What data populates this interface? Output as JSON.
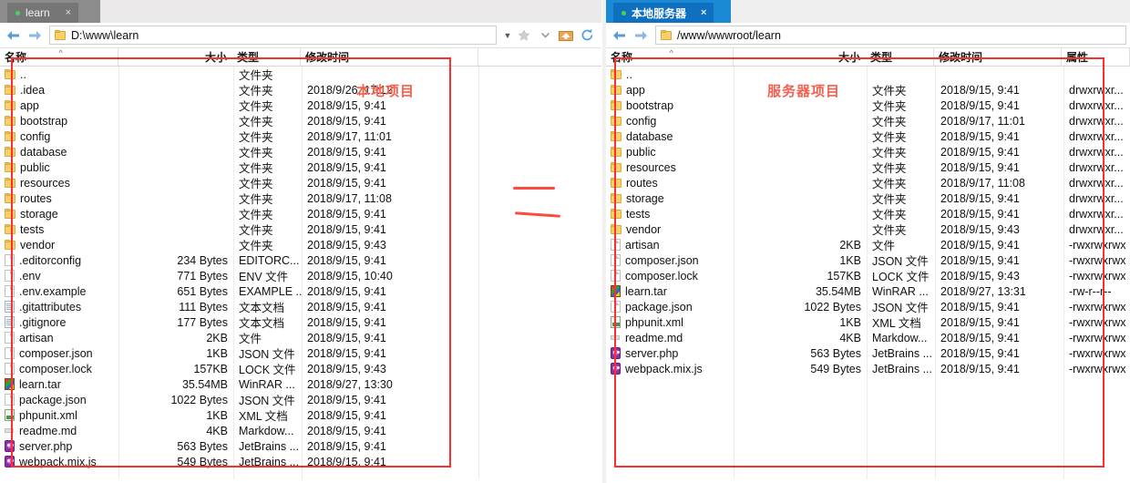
{
  "left_panel": {
    "tab": {
      "label": "learn",
      "close": "×",
      "status_dot": "connected"
    },
    "address": {
      "path": "D:\\www\\learn",
      "placeholder": "D:\\www\\learn"
    },
    "toolbar": {
      "back": "back-arrow",
      "forward": "forward-arrow",
      "dropdown": "chevron-down-icon",
      "favorite": "star-icon",
      "favorite_menu": "chevron-down-icon",
      "home": "home-folder-icon",
      "refresh": "refresh-icon"
    },
    "columns": [
      "名称",
      "大小",
      "类型",
      "修改时间"
    ],
    "sort_indicator": "^",
    "annotation": "本地项目",
    "rows": [
      {
        "name": "..",
        "icon": "folder",
        "size": "",
        "type": "文件夹",
        "date": ""
      },
      {
        "name": ".idea",
        "icon": "folder",
        "size": "",
        "type": "文件夹",
        "date": "2018/9/26, 17:12"
      },
      {
        "name": "app",
        "icon": "folder",
        "size": "",
        "type": "文件夹",
        "date": "2018/9/15, 9:41"
      },
      {
        "name": "bootstrap",
        "icon": "folder",
        "size": "",
        "type": "文件夹",
        "date": "2018/9/15, 9:41"
      },
      {
        "name": "config",
        "icon": "folder",
        "size": "",
        "type": "文件夹",
        "date": "2018/9/17, 11:01"
      },
      {
        "name": "database",
        "icon": "folder",
        "size": "",
        "type": "文件夹",
        "date": "2018/9/15, 9:41"
      },
      {
        "name": "public",
        "icon": "folder",
        "size": "",
        "type": "文件夹",
        "date": "2018/9/15, 9:41"
      },
      {
        "name": "resources",
        "icon": "folder",
        "size": "",
        "type": "文件夹",
        "date": "2018/9/15, 9:41"
      },
      {
        "name": "routes",
        "icon": "folder",
        "size": "",
        "type": "文件夹",
        "date": "2018/9/17, 11:08"
      },
      {
        "name": "storage",
        "icon": "folder",
        "size": "",
        "type": "文件夹",
        "date": "2018/9/15, 9:41"
      },
      {
        "name": "tests",
        "icon": "folder",
        "size": "",
        "type": "文件夹",
        "date": "2018/9/15, 9:41"
      },
      {
        "name": "vendor",
        "icon": "folder",
        "size": "",
        "type": "文件夹",
        "date": "2018/9/15, 9:43"
      },
      {
        "name": ".editorconfig",
        "icon": "doc",
        "size": "234 Bytes",
        "type": "EDITORC...",
        "date": "2018/9/15, 9:41"
      },
      {
        "name": ".env",
        "icon": "doc",
        "size": "771 Bytes",
        "type": "ENV 文件",
        "date": "2018/9/15, 10:40"
      },
      {
        "name": ".env.example",
        "icon": "doc",
        "size": "651 Bytes",
        "type": "EXAMPLE ...",
        "date": "2018/9/15, 9:41"
      },
      {
        "name": ".gitattributes",
        "icon": "txt",
        "size": "111 Bytes",
        "type": "文本文档",
        "date": "2018/9/15, 9:41"
      },
      {
        "name": ".gitignore",
        "icon": "txt",
        "size": "177 Bytes",
        "type": "文本文档",
        "date": "2018/9/15, 9:41"
      },
      {
        "name": "artisan",
        "icon": "doc",
        "size": "2KB",
        "type": "文件",
        "date": "2018/9/15, 9:41"
      },
      {
        "name": "composer.json",
        "icon": "doc",
        "size": "1KB",
        "type": "JSON 文件",
        "date": "2018/9/15, 9:41"
      },
      {
        "name": "composer.lock",
        "icon": "doc",
        "size": "157KB",
        "type": "LOCK 文件",
        "date": "2018/9/15, 9:43"
      },
      {
        "name": "learn.tar",
        "icon": "rar",
        "size": "35.54MB",
        "type": "WinRAR ...",
        "date": "2018/9/27, 13:30"
      },
      {
        "name": "package.json",
        "icon": "doc",
        "size": "1022 Bytes",
        "type": "JSON 文件",
        "date": "2018/9/15, 9:41"
      },
      {
        "name": "phpunit.xml",
        "icon": "xml",
        "size": "1KB",
        "type": "XML 文档",
        "date": "2018/9/15, 9:41"
      },
      {
        "name": "readme.md",
        "icon": "md",
        "size": "4KB",
        "type": "Markdow...",
        "date": "2018/9/15, 9:41"
      },
      {
        "name": "server.php",
        "icon": "php",
        "size": "563 Bytes",
        "type": "JetBrains ...",
        "date": "2018/9/15, 9:41"
      },
      {
        "name": "webpack.mix.js",
        "icon": "php",
        "size": "549 Bytes",
        "type": "JetBrains ...",
        "date": "2018/9/15, 9:41"
      }
    ]
  },
  "right_panel": {
    "tab": {
      "label": "本地服务器",
      "close": "×",
      "status_dot": "connected"
    },
    "address": {
      "path": "/www/wwwroot/learn",
      "placeholder": "/www/wwwroot/learn"
    },
    "toolbar": {
      "back": "back-arrow",
      "forward": "forward-arrow"
    },
    "columns": [
      "名称",
      "大小",
      "类型",
      "修改时间",
      "属性"
    ],
    "sort_indicator": "^",
    "annotation": "服务器项目",
    "rows": [
      {
        "name": "..",
        "icon": "folder",
        "size": "",
        "type": "",
        "date": "",
        "attr": ""
      },
      {
        "name": "app",
        "icon": "folder",
        "size": "",
        "type": "文件夹",
        "date": "2018/9/15, 9:41",
        "attr": "drwxrwxr..."
      },
      {
        "name": "bootstrap",
        "icon": "folder",
        "size": "",
        "type": "文件夹",
        "date": "2018/9/15, 9:41",
        "attr": "drwxrwxr..."
      },
      {
        "name": "config",
        "icon": "folder",
        "size": "",
        "type": "文件夹",
        "date": "2018/9/17, 11:01",
        "attr": "drwxrwxr..."
      },
      {
        "name": "database",
        "icon": "folder",
        "size": "",
        "type": "文件夹",
        "date": "2018/9/15, 9:41",
        "attr": "drwxrwxr..."
      },
      {
        "name": "public",
        "icon": "folder",
        "size": "",
        "type": "文件夹",
        "date": "2018/9/15, 9:41",
        "attr": "drwxrwxr..."
      },
      {
        "name": "resources",
        "icon": "folder",
        "size": "",
        "type": "文件夹",
        "date": "2018/9/15, 9:41",
        "attr": "drwxrwxr..."
      },
      {
        "name": "routes",
        "icon": "folder",
        "size": "",
        "type": "文件夹",
        "date": "2018/9/17, 11:08",
        "attr": "drwxrwxr..."
      },
      {
        "name": "storage",
        "icon": "folder",
        "size": "",
        "type": "文件夹",
        "date": "2018/9/15, 9:41",
        "attr": "drwxrwxr..."
      },
      {
        "name": "tests",
        "icon": "folder",
        "size": "",
        "type": "文件夹",
        "date": "2018/9/15, 9:41",
        "attr": "drwxrwxr..."
      },
      {
        "name": "vendor",
        "icon": "folder",
        "size": "",
        "type": "文件夹",
        "date": "2018/9/15, 9:43",
        "attr": "drwxrwxr..."
      },
      {
        "name": "artisan",
        "icon": "doc",
        "size": "2KB",
        "type": "文件",
        "date": "2018/9/15, 9:41",
        "attr": "-rwxrwxrwx"
      },
      {
        "name": "composer.json",
        "icon": "doc",
        "size": "1KB",
        "type": "JSON 文件",
        "date": "2018/9/15, 9:41",
        "attr": "-rwxrwxrwx"
      },
      {
        "name": "composer.lock",
        "icon": "doc",
        "size": "157KB",
        "type": "LOCK 文件",
        "date": "2018/9/15, 9:43",
        "attr": "-rwxrwxrwx"
      },
      {
        "name": "learn.tar",
        "icon": "rar",
        "size": "35.54MB",
        "type": "WinRAR ...",
        "date": "2018/9/27, 13:31",
        "attr": "-rw-r--r--"
      },
      {
        "name": "package.json",
        "icon": "doc",
        "size": "1022 Bytes",
        "type": "JSON 文件",
        "date": "2018/9/15, 9:41",
        "attr": "-rwxrwxrwx"
      },
      {
        "name": "phpunit.xml",
        "icon": "xml",
        "size": "1KB",
        "type": "XML 文档",
        "date": "2018/9/15, 9:41",
        "attr": "-rwxrwxrwx"
      },
      {
        "name": "readme.md",
        "icon": "md",
        "size": "4KB",
        "type": "Markdow...",
        "date": "2018/9/15, 9:41",
        "attr": "-rwxrwxrwx"
      },
      {
        "name": "server.php",
        "icon": "php",
        "size": "563 Bytes",
        "type": "JetBrains ...",
        "date": "2018/9/15, 9:41",
        "attr": "-rwxrwxrwx"
      },
      {
        "name": "webpack.mix.js",
        "icon": "php",
        "size": "549 Bytes",
        "type": "JetBrains ...",
        "date": "2018/9/15, 9:41",
        "attr": "-rwxrwxrwx"
      }
    ]
  }
}
